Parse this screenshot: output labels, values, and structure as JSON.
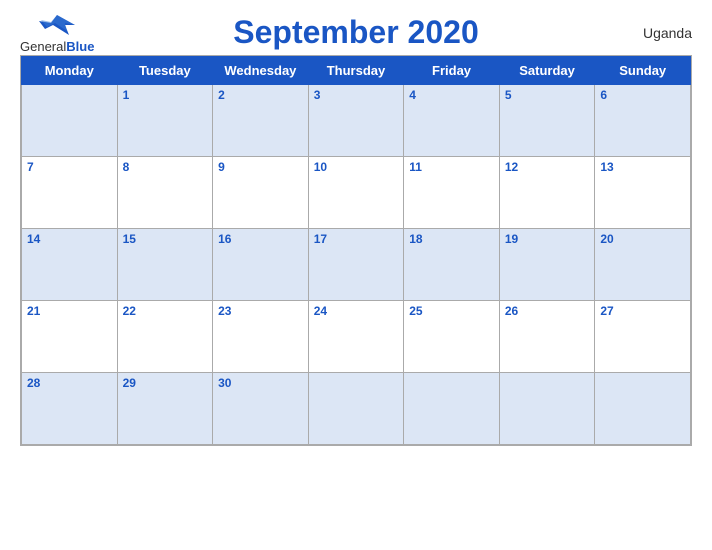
{
  "header": {
    "title": "September 2020",
    "country": "Uganda",
    "logo_general": "General",
    "logo_blue": "Blue"
  },
  "days": [
    "Monday",
    "Tuesday",
    "Wednesday",
    "Thursday",
    "Friday",
    "Saturday",
    "Sunday"
  ],
  "weeks": [
    [
      null,
      1,
      2,
      3,
      4,
      5,
      6
    ],
    [
      7,
      8,
      9,
      10,
      11,
      12,
      13
    ],
    [
      14,
      15,
      16,
      17,
      18,
      19,
      20
    ],
    [
      21,
      22,
      23,
      24,
      25,
      26,
      27
    ],
    [
      28,
      29,
      30,
      null,
      null,
      null,
      null
    ]
  ]
}
